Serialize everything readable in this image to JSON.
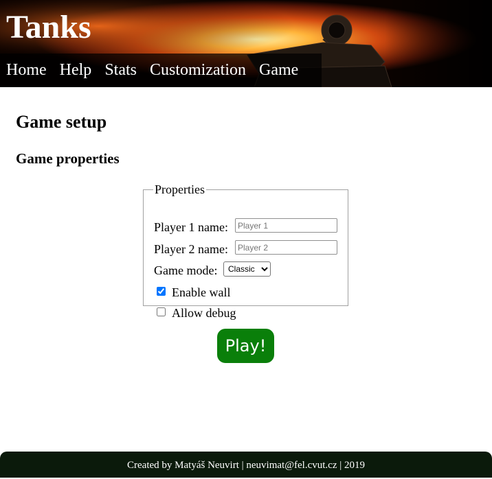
{
  "header": {
    "site_title": "Tanks",
    "nav": [
      "Home",
      "Help",
      "Stats",
      "Customization",
      "Game"
    ]
  },
  "main": {
    "heading": "Game setup",
    "subheading": "Game properties",
    "fieldset_legend": "Properties",
    "player1": {
      "label": "Player 1 name:",
      "placeholder": "Player 1",
      "value": ""
    },
    "player2": {
      "label": "Player 2 name:",
      "placeholder": "Player 2",
      "value": ""
    },
    "game_mode": {
      "label": "Game mode:",
      "selected": "Classic"
    },
    "enable_wall": {
      "label": "Enable wall",
      "checked": true
    },
    "allow_debug": {
      "label": "Allow debug",
      "checked": false
    },
    "play_button": "Play!"
  },
  "footer": {
    "text": "Created by Matyáš Neuvirt | neuvimat@fel.cvut.cz | 2019"
  },
  "colors": {
    "play_button": "#0a7f0a",
    "footer_bg": "#0b1a0b",
    "checkbox_accent": "#0075ff"
  }
}
